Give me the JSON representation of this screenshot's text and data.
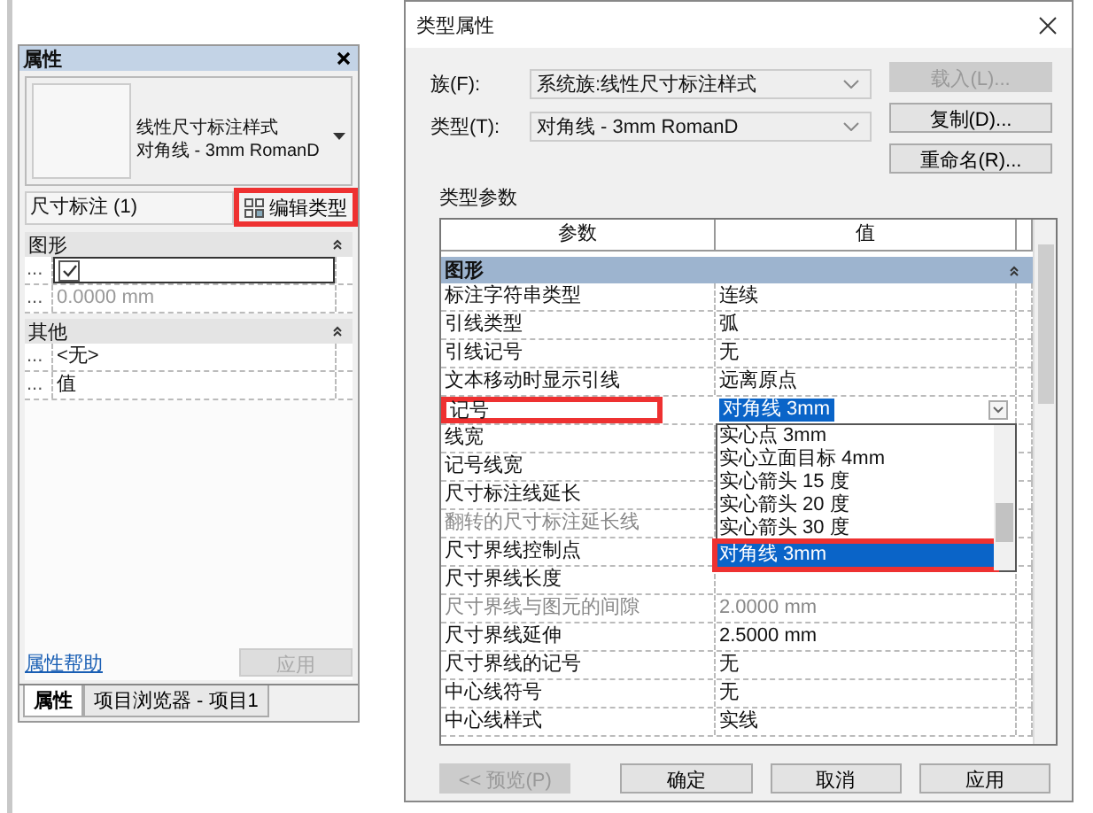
{
  "properties_panel": {
    "title": "属性",
    "type_selector": {
      "line1": "线性尺寸标注样式",
      "line2": "对角线 - 3mm RomanD"
    },
    "instance_filter": "尺寸标注 (1)",
    "edit_type_button": {
      "label": "编辑类型",
      "highlighted": true
    },
    "groups": [
      {
        "title": "图形",
        "rows": [
          {
            "label": "...",
            "kind": "checkbox",
            "checked": true
          },
          {
            "label": "...",
            "kind": "text",
            "value": "0.0000 mm",
            "disabled": true
          }
        ]
      },
      {
        "title": "其他",
        "rows": [
          {
            "label": "...",
            "kind": "text",
            "value": "<无>",
            "disabled": false
          },
          {
            "label": "...",
            "kind": "text",
            "value": "值",
            "disabled": false
          }
        ]
      }
    ],
    "help_link": "属性帮助",
    "apply_button": {
      "label": "应用",
      "disabled": true
    },
    "tabs": [
      {
        "label": "属性",
        "selected": true
      },
      {
        "label": "项目浏览器 - 项目1",
        "selected": false
      }
    ]
  },
  "type_dialog": {
    "title": "类型属性",
    "fields": [
      {
        "label": "族(F):",
        "value": "系统族:线性尺寸标注样式"
      },
      {
        "label": "类型(T):",
        "value": "对角线 - 3mm RomanD"
      }
    ],
    "side_buttons": [
      {
        "label": "载入(L)...",
        "disabled": true
      },
      {
        "label": "复制(D)...",
        "disabled": false
      },
      {
        "label": "重命名(R)...",
        "disabled": false
      }
    ],
    "section_label": "类型参数",
    "columns": [
      "参数",
      "值"
    ],
    "group": "图形",
    "rows": [
      {
        "param": "标注字符串类型",
        "value": "连续",
        "kind": "text",
        "disabled": false,
        "highlighted": false
      },
      {
        "param": "引线类型",
        "value": "弧",
        "kind": "text",
        "disabled": false,
        "highlighted": false
      },
      {
        "param": "引线记号",
        "value": "无",
        "kind": "text",
        "disabled": false,
        "highlighted": false
      },
      {
        "param": "文本移动时显示引线",
        "value": "远离原点",
        "kind": "text",
        "disabled": false,
        "highlighted": false
      },
      {
        "param": "记号",
        "value": "对角线 3mm",
        "kind": "combo",
        "disabled": false,
        "highlighted": true
      },
      {
        "param": "线宽",
        "kind": "text",
        "disabled": false,
        "highlighted": false
      },
      {
        "param": "记号线宽",
        "kind": "text",
        "disabled": false,
        "highlighted": false
      },
      {
        "param": "尺寸标注线延长",
        "kind": "text",
        "disabled": false,
        "highlighted": false
      },
      {
        "param": "翻转的尺寸标注延长线",
        "kind": "text",
        "disabled": true,
        "highlighted": false
      },
      {
        "param": "尺寸界线控制点",
        "kind": "text",
        "disabled": false,
        "highlighted": false
      },
      {
        "param": "尺寸界线长度",
        "kind": "text",
        "disabled": false,
        "highlighted": false
      },
      {
        "param": "尺寸界线与图元的间隙",
        "value": "2.0000 mm",
        "kind": "text",
        "disabled": true,
        "highlighted": false
      },
      {
        "param": "尺寸界线延伸",
        "value": "2.5000 mm",
        "kind": "text",
        "disabled": false,
        "highlighted": false
      },
      {
        "param": "尺寸界线的记号",
        "value": "无",
        "kind": "text",
        "disabled": false,
        "highlighted": false
      },
      {
        "param": "中心线符号",
        "value": "无",
        "kind": "text",
        "disabled": false,
        "highlighted": false
      },
      {
        "param": "中心线样式",
        "value": "实线",
        "kind": "text",
        "disabled": false,
        "highlighted": false
      }
    ],
    "dropdown_options": [
      {
        "label": "实心点 3mm",
        "selected": false,
        "highlighted": false
      },
      {
        "label": "实心立面目标 4mm",
        "selected": false,
        "highlighted": false
      },
      {
        "label": "实心箭头 15 度",
        "selected": false,
        "highlighted": false
      },
      {
        "label": "实心箭头 20 度",
        "selected": false,
        "highlighted": false
      },
      {
        "label": "实心箭头 30 度",
        "selected": false,
        "highlighted": false
      },
      {
        "label": "对角线 3mm",
        "selected": true,
        "highlighted": true
      }
    ],
    "buttons": [
      {
        "label": "<< 预览(P)",
        "disabled": true
      },
      {
        "label": "确定",
        "disabled": false
      },
      {
        "label": "取消",
        "disabled": false
      },
      {
        "label": "应用",
        "disabled": false
      }
    ]
  }
}
